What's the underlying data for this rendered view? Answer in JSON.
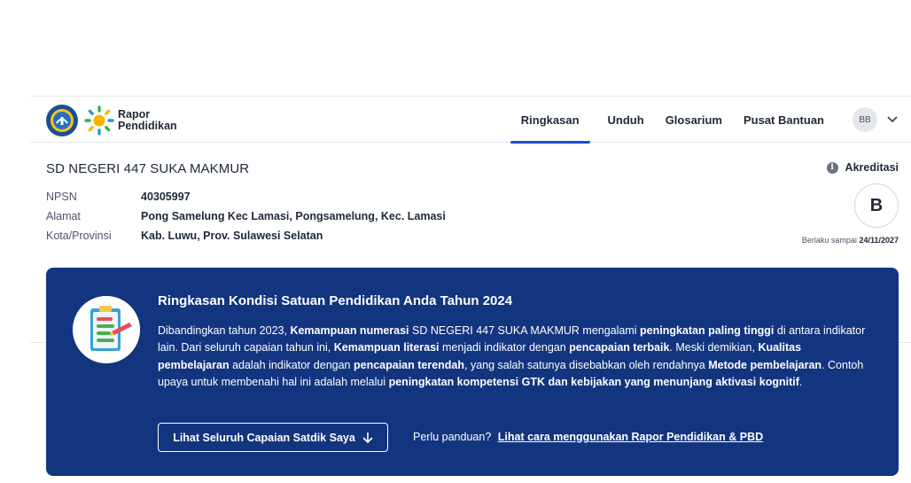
{
  "header": {
    "logo_line1": "Rapor",
    "logo_line2": "Pendidikan",
    "nav": [
      "Ringkasan",
      "Unduh",
      "Glosarium",
      "Pusat Bantuan"
    ],
    "active_nav": "Ringkasan",
    "avatar_initials": "BB"
  },
  "school": {
    "name": "SD NEGERI 447 SUKA MAKMUR",
    "npsn_label": "NPSN",
    "npsn": "40305997",
    "alamat_label": "Alamat",
    "alamat": "Pong Samelung Kec Lamasi, Pongsamelung, Kec. Lamasi",
    "kota_label": "Kota/Provinsi",
    "kota": "Kab. Luwu, Prov. Sulawesi Selatan"
  },
  "accreditation": {
    "label": "Akreditasi",
    "grade": "B",
    "valid_prefix": "Berlaku sampai",
    "valid_date": "24/11/2027"
  },
  "summary": {
    "title": "Ringkasan Kondisi Satuan Pendidikan Anda Tahun 2024",
    "body": [
      {
        "t": "Dibandingkan tahun 2023, ",
        "b": false
      },
      {
        "t": "Kemampuan numerasi",
        "b": true
      },
      {
        "t": " SD NEGERI 447 SUKA MAKMUR mengalami ",
        "b": false
      },
      {
        "t": "peningkatan paling tinggi",
        "b": true
      },
      {
        "t": " di antara indikator lain. Dari seluruh capaian tahun ini, ",
        "b": false
      },
      {
        "t": "Kemampuan literasi",
        "b": true
      },
      {
        "t": " menjadi indikator dengan ",
        "b": false
      },
      {
        "t": "pencapaian terbaik",
        "b": true
      },
      {
        "t": ". Meski demikian, ",
        "b": false
      },
      {
        "t": "Kualitas pembelajaran",
        "b": true
      },
      {
        "t": " adalah indikator dengan ",
        "b": false
      },
      {
        "t": "pencapaian terendah",
        "b": true
      },
      {
        "t": ", yang salah satunya disebabkan oleh rendahnya ",
        "b": false
      },
      {
        "t": "Metode pembelajaran",
        "b": true
      },
      {
        "t": ". Contoh upaya untuk membenahi hal ini adalah melalui ",
        "b": false
      },
      {
        "t": "peningkatan kompetensi GTK dan kebijakan yang menunjang aktivasi kognitif",
        "b": true
      },
      {
        "t": ".",
        "b": false
      }
    ],
    "button_label": "Lihat Seluruh Capaian Satdik Saya",
    "help_text": "Perlu panduan?",
    "help_link": "Lihat cara menggunakan Rapor Pendidikan & PBD"
  },
  "colors": {
    "card_bg": "#13357f",
    "accent": "#1d4ed8"
  }
}
